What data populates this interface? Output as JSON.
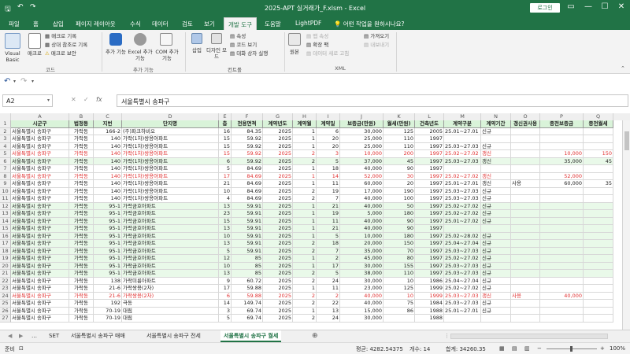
{
  "titlebar": {
    "title": "2025-APT 실거래가_F.xlsm  -  Excel",
    "login": "로그인"
  },
  "tabs": [
    "파일",
    "홈",
    "삽입",
    "페이지 레이아웃",
    "수식",
    "데이터",
    "검토",
    "보기",
    "개발 도구",
    "도움말",
    "LightPDF"
  ],
  "active_tab": "개발 도구",
  "tell_me": "어떤 작업을 원하시나요?",
  "ribbon": {
    "code": {
      "label": "코드",
      "visual_basic": "Visual Basic",
      "macro": "매크로",
      "record": "매크로 기록",
      "relative": "상대 참조로 기록",
      "security": "매크로 보안"
    },
    "addins": {
      "label": "추가 기능",
      "addin": "추가 기능",
      "excel_addin": "Excel 추가 기능",
      "com_addin": "COM 추가 기능"
    },
    "controls": {
      "label": "컨트롤",
      "insert": "삽입",
      "design": "디자인 모드",
      "props": "속성",
      "view_code": "코드 보기",
      "dialog": "대화 상자 실행"
    },
    "xml": {
      "label": "XML",
      "source": "원본",
      "map_props": "맵 속성",
      "ext_pack": "확장 팩",
      "refresh": "데이터 새로 고침",
      "import": "가져오기",
      "export": "내보내기"
    }
  },
  "formula_bar": {
    "name_box": "A2",
    "formula": "서울특별시 송파구"
  },
  "columns": [
    "A",
    "B",
    "C",
    "D",
    "E",
    "F",
    "G",
    "H",
    "I",
    "J",
    "K",
    "L",
    "M",
    "N",
    "O",
    "P",
    "Q"
  ],
  "header_row": [
    "시군구",
    "법정동",
    "지번",
    "단지명",
    "층",
    "전용면적",
    "계약년도",
    "계약월",
    "계약일",
    "보증금(만원)",
    "월세(만원)",
    "건축년도",
    "계약구분",
    "계약기간",
    "갱신권사용",
    "종전보증금",
    "종전월세"
  ],
  "rows": [
    {
      "n": 2,
      "style": "",
      "v": [
        "서울특별시 송파구",
        "가락동",
        "166-2",
        "(주)파크하비오",
        "16",
        "84.35",
        "2025",
        "1",
        "6",
        "30,000",
        "125",
        "2005",
        "25.01~27.01",
        "신규",
        "",
        "",
        ""
      ]
    },
    {
      "n": 3,
      "style": "",
      "v": [
        "서울특별시 송파구",
        "가락동",
        "140",
        "가락(1차)쌍용아파트",
        "15",
        "59.92",
        "2025",
        "1",
        "20",
        "25,000",
        "110",
        "1997",
        "",
        "",
        "",
        "",
        ""
      ]
    },
    {
      "n": 4,
      "style": "",
      "v": [
        "서울특별시 송파구",
        "가락동",
        "140",
        "가락(1차)쌍용아파트",
        "15",
        "59.92",
        "2025",
        "1",
        "20",
        "25,000",
        "110",
        "1997",
        "25.03~27.03",
        "신규",
        "",
        "",
        ""
      ]
    },
    {
      "n": 5,
      "style": "red",
      "v": [
        "서울특별시 송파구",
        "가락동",
        "140",
        "가락(1차)쌍용아파트",
        "15",
        "59.92",
        "2025",
        "2",
        "3",
        "10,000",
        "200",
        "1997",
        "25.02~27.02",
        "갱신",
        "",
        "10,000",
        "150"
      ]
    },
    {
      "n": 6,
      "style": "green",
      "v": [
        "서울특별시 송파구",
        "가락동",
        "140",
        "가락(1차)쌍용아파트",
        "6",
        "59.92",
        "2025",
        "2",
        "5",
        "37,000",
        "45",
        "1997",
        "25.03~27.03",
        "갱신",
        "",
        "35,000",
        "45"
      ]
    },
    {
      "n": 7,
      "style": "",
      "v": [
        "서울특별시 송파구",
        "가락동",
        "140",
        "가락(1차)쌍용아파트",
        "5",
        "84.69",
        "2025",
        "1",
        "18",
        "40,000",
        "90",
        "1997",
        "",
        "",
        "",
        "",
        ""
      ]
    },
    {
      "n": 8,
      "style": "red",
      "v": [
        "서울특별시 송파구",
        "가락동",
        "140",
        "가락(1차)쌍용아파트",
        "17",
        "84.69",
        "2025",
        "1",
        "14",
        "52,000",
        "30",
        "1997",
        "25.02~27.02",
        "갱신",
        "",
        "52,000",
        ""
      ]
    },
    {
      "n": 9,
      "style": "",
      "v": [
        "서울특별시 송파구",
        "가락동",
        "140",
        "가락(1차)쌍용아파트",
        "21",
        "84.69",
        "2025",
        "1",
        "11",
        "60,000",
        "20",
        "1997",
        "25.01~27.01",
        "갱신",
        "사용",
        "60,000",
        "35"
      ]
    },
    {
      "n": 10,
      "style": "",
      "v": [
        "서울특별시 송파구",
        "가락동",
        "140",
        "가락(1차)쌍용아파트",
        "10",
        "84.69",
        "2025",
        "2",
        "19",
        "17,000",
        "190",
        "1997",
        "25.03~27.03",
        "신규",
        "",
        "",
        ""
      ]
    },
    {
      "n": 11,
      "style": "",
      "v": [
        "서울특별시 송파구",
        "가락동",
        "140",
        "가락(1차)쌍용아파트",
        "4",
        "84.69",
        "2025",
        "2",
        "7",
        "40,000",
        "100",
        "1997",
        "25.03~27.03",
        "신규",
        "",
        "",
        ""
      ]
    },
    {
      "n": 12,
      "style": "green",
      "v": [
        "서울특별시 송파구",
        "가락동",
        "95-1",
        "가락금호아파트",
        "13",
        "59.91",
        "2025",
        "1",
        "21",
        "40,000",
        "50",
        "1997",
        "25.02~27.02",
        "신규",
        "",
        "",
        ""
      ]
    },
    {
      "n": 13,
      "style": "green",
      "v": [
        "서울특별시 송파구",
        "가락동",
        "95-1",
        "가락금호아파트",
        "23",
        "59.91",
        "2025",
        "1",
        "19",
        "5,000",
        "180",
        "1997",
        "25.02~27.02",
        "신규",
        "",
        "",
        ""
      ]
    },
    {
      "n": 14,
      "style": "green",
      "v": [
        "서울특별시 송파구",
        "가락동",
        "95-1",
        "가락금호아파트",
        "15",
        "59.91",
        "2025",
        "1",
        "11",
        "40,000",
        "90",
        "1997",
        "25.01~27.02",
        "신규",
        "",
        "",
        ""
      ]
    },
    {
      "n": 15,
      "style": "green",
      "v": [
        "서울특별시 송파구",
        "가락동",
        "95-1",
        "가락금호아파트",
        "13",
        "59.91",
        "2025",
        "1",
        "21",
        "40,000",
        "90",
        "1997",
        "",
        "",
        "",
        "",
        ""
      ]
    },
    {
      "n": 16,
      "style": "green",
      "v": [
        "서울특별시 송파구",
        "가락동",
        "95-1",
        "가락금호아파트",
        "10",
        "59.91",
        "2025",
        "1",
        "5",
        "10,000",
        "180",
        "1997",
        "25.02~28.02",
        "신규",
        "",
        "",
        ""
      ]
    },
    {
      "n": 17,
      "style": "green",
      "v": [
        "서울특별시 송파구",
        "가락동",
        "95-1",
        "가락금호아파트",
        "13",
        "59.91",
        "2025",
        "2",
        "18",
        "20,000",
        "150",
        "1997",
        "25.04~27.04",
        "신규",
        "",
        "",
        ""
      ]
    },
    {
      "n": 18,
      "style": "green",
      "v": [
        "서울특별시 송파구",
        "가락동",
        "95-1",
        "가락금호아파트",
        "5",
        "59.91",
        "2025",
        "2",
        "7",
        "35,000",
        "70",
        "1997",
        "25.03~27.03",
        "신규",
        "",
        "",
        ""
      ]
    },
    {
      "n": 19,
      "style": "green",
      "v": [
        "서울특별시 송파구",
        "가락동",
        "95-1",
        "가락금호아파트",
        "12",
        "85",
        "2025",
        "1",
        "2",
        "45,000",
        "80",
        "1997",
        "25.02~27.02",
        "신규",
        "",
        "",
        ""
      ]
    },
    {
      "n": 20,
      "style": "green",
      "v": [
        "서울특별시 송파구",
        "가락동",
        "95-1",
        "가락금호아파트",
        "10",
        "85",
        "2025",
        "1",
        "17",
        "30,000",
        "155",
        "1997",
        "25.03~27.03",
        "신규",
        "",
        "",
        ""
      ]
    },
    {
      "n": 21,
      "style": "green",
      "v": [
        "서울특별시 송파구",
        "가락동",
        "95-1",
        "가락금호아파트",
        "13",
        "85",
        "2025",
        "2",
        "5",
        "38,000",
        "110",
        "1997",
        "25.03~27.03",
        "신규",
        "",
        "",
        ""
      ]
    },
    {
      "n": 22,
      "style": "",
      "v": [
        "서울특별시 송파구",
        "가락동",
        "138",
        "가락미륭아파트",
        "9",
        "60.72",
        "2025",
        "2",
        "24",
        "30,000",
        "10",
        "1986",
        "25.04~27.04",
        "신규",
        "",
        "",
        ""
      ]
    },
    {
      "n": 23,
      "style": "",
      "v": [
        "서울특별시 송파구",
        "가락동",
        "21-6",
        "가락쌍용(2차)",
        "17",
        "59.88",
        "2025",
        "1",
        "11",
        "23,000",
        "125",
        "1999",
        "25.02~27.02",
        "신규",
        "",
        "",
        ""
      ]
    },
    {
      "n": 24,
      "style": "red",
      "v": [
        "서울특별시 송파구",
        "가락동",
        "21-6",
        "가락쌍용(2차)",
        "6",
        "59.88",
        "2025",
        "2",
        "2",
        "40,000",
        "10",
        "1999",
        "25.03~27.03",
        "갱신",
        "사용",
        "40,000",
        ""
      ]
    },
    {
      "n": 25,
      "style": "",
      "v": [
        "서울특별시 송파구",
        "가락동",
        "192",
        "극동",
        "14",
        "149.74",
        "2025",
        "2",
        "22",
        "40,000",
        "75",
        "1984",
        "25.03~27.03",
        "신규",
        "",
        "",
        ""
      ]
    },
    {
      "n": 26,
      "style": "",
      "v": [
        "서울특별시 송파구",
        "가락동",
        "70-19",
        "대림",
        "3",
        "69.74",
        "2025",
        "1",
        "13",
        "15,000",
        "86",
        "1988",
        "25.01~27.01",
        "신규",
        "",
        "",
        ""
      ]
    },
    {
      "n": 27,
      "style": "",
      "v": [
        "서울특별시 송파구",
        "가락동",
        "70-19",
        "대림",
        "5",
        "69.74",
        "2025",
        "2",
        "24",
        "30,000",
        "",
        "1988",
        "",
        "",
        "",
        "",
        ""
      ]
    }
  ],
  "sheet_tabs": [
    "SET",
    "서울특별시 송파구 매매",
    "서울특별시 송파구 전세",
    "서울특별시 송파구 월세"
  ],
  "active_sheet": "서울특별시 송파구 월세",
  "status": {
    "ready": "준비",
    "average": "평균: 4282.54375",
    "count": "개수: 14",
    "sum": "합계: 34260.35",
    "zoom": "100%"
  }
}
